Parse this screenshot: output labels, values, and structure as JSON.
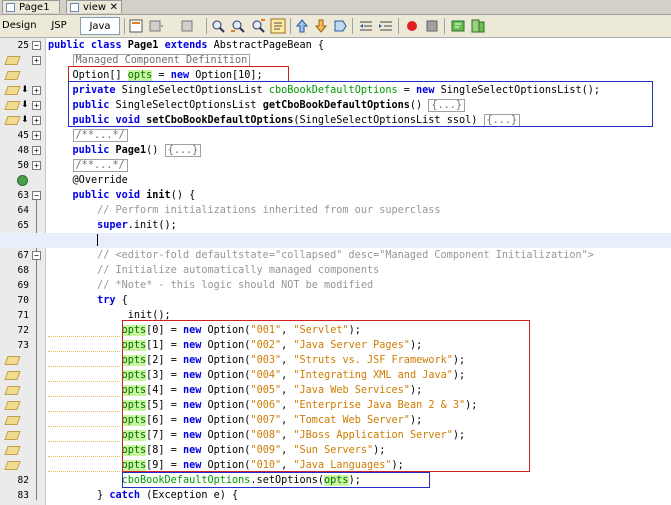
{
  "tabs": [
    {
      "label": "Page1"
    },
    {
      "label": "view"
    }
  ],
  "views": {
    "design": "Design",
    "jsp": "JSP",
    "java": "Java"
  },
  "toolbar_icons": [
    "history-icon",
    "back-icon",
    "forward-icon",
    "find-icon",
    "find-prev-icon",
    "find-next-icon",
    "toggle-highlight-icon",
    "prev-bookmark-icon",
    "next-bookmark-icon",
    "toggle-bookmark-icon",
    "shift-left-icon",
    "shift-right-icon",
    "record-macro-icon",
    "stop-macro-icon",
    "run-icon",
    "diff-icon"
  ],
  "editor": {
    "lines": [
      {
        "num": "25",
        "fold": "minus"
      },
      {
        "num": "",
        "fold": "plus",
        "badge": true
      },
      {
        "num": "",
        "badge": true
      },
      {
        "num": "",
        "fold": "plus",
        "badge": true,
        "arrow": true
      },
      {
        "num": "",
        "fold": "plus",
        "badge": true,
        "arrow": true
      },
      {
        "num": "",
        "fold": "plus",
        "badge": true,
        "arrow": true
      },
      {
        "num": "45",
        "fold": "plus"
      },
      {
        "num": "48",
        "fold": "plus"
      },
      {
        "num": "50",
        "fold": "plus"
      },
      {
        "num": "",
        "override": true
      },
      {
        "num": "63",
        "fold": "minus"
      },
      {
        "num": "64"
      },
      {
        "num": "65"
      },
      {
        "num": "",
        "current": true
      },
      {
        "num": "67",
        "fold": "minus"
      },
      {
        "num": "68"
      },
      {
        "num": "69"
      },
      {
        "num": "70"
      },
      {
        "num": "71"
      },
      {
        "num": "72"
      },
      {
        "num": "73"
      },
      {
        "num": "",
        "badge": true
      },
      {
        "num": "",
        "badge": true
      },
      {
        "num": "",
        "badge": true
      },
      {
        "num": "",
        "badge": true
      },
      {
        "num": "",
        "badge": true
      },
      {
        "num": "",
        "badge": true
      },
      {
        "num": "",
        "badge": true
      },
      {
        "num": "",
        "badge": true
      },
      {
        "num": "82"
      },
      {
        "num": "83"
      }
    ],
    "code": [
      "<span class=\"kw\">public class</span> <span class=\"b\">Page1</span> <span class=\"kw\">extends</span> AbstractPageBean {",
      "    <span class=\"folded\">Managed Component Definition</span>",
      "    Option[] <span class=\"opts\">opts</span> = <span class=\"kw\">new</span> Option[10];",
      "    <span class=\"kw\">private</span> SingleSelectOptionsList <span class=\"fld\">cboBookDefaultOptions</span> = <span class=\"kw\">new</span> SingleSelectOptionsList();",
      "    <span class=\"kw\">public</span> SingleSelectOptionsList <span class=\"b\">getCboBookDefaultOptions</span>() <span class=\"folded\">{...}</span>",
      "    <span class=\"kw\">public void</span> <span class=\"b\">setCboBookDefaultOptions</span>(SingleSelectOptionsList ssol) <span class=\"folded\">{...}</span>",
      "    <span class=\"folded cm\">/**...*/</span>",
      "    <span class=\"kw\">public</span> <span class=\"b\">Page1</span>() <span class=\"folded\">{...}</span>",
      "    <span class=\"folded cm\">/**...*/</span>",
      "    <span class=\"ann\">@Override</span>",
      "    <span class=\"kw\">public void</span> <span class=\"b\">init</span>() {",
      "        <span class=\"cm\">// Perform initializations inherited from our superclass</span>",
      "        <span class=\"kw\">super</span>.init();",
      "        <span class=\"caret\"></span>",
      "        <span class=\"cm\">// &lt;editor-fold defaultstate=\"collapsed\" desc=\"Managed Component Initialization\"&gt;</span>",
      "        <span class=\"cm\">// Initialize automatically managed components</span>",
      "        <span class=\"cm\">// *Note* - this logic should NOT be modified</span>",
      "        <span class=\"kw\">try</span> {",
      "            _init();",
      "            <span class=\"opts\">opts</span>[0] = <span class=\"kw\">new</span> Option(<span class=\"str\">\"001\"</span>, <span class=\"str\">\"Servlet\"</span>);",
      "            <span class=\"opts\">opts</span>[1] = <span class=\"kw\">new</span> Option(<span class=\"str\">\"002\"</span>, <span class=\"str\">\"Java Server Pages\"</span>);",
      "            <span class=\"opts\">opts</span>[2] = <span class=\"kw\">new</span> Option(<span class=\"str\">\"003\"</span>, <span class=\"str\">\"Struts vs. JSF Framework\"</span>);",
      "            <span class=\"opts\">opts</span>[3] = <span class=\"kw\">new</span> Option(<span class=\"str\">\"004\"</span>, <span class=\"str\">\"Integrating XML and Java\"</span>);",
      "            <span class=\"opts\">opts</span>[4] = <span class=\"kw\">new</span> Option(<span class=\"str\">\"005\"</span>, <span class=\"str\">\"Java Web Services\"</span>);",
      "            <span class=\"opts\">opts</span>[5] = <span class=\"kw\">new</span> Option(<span class=\"str\">\"006\"</span>, <span class=\"str\">\"Enterprise Java Bean 2 &amp; 3\"</span>);",
      "            <span class=\"opts\">opts</span>[6] = <span class=\"kw\">new</span> Option(<span class=\"str\">\"007\"</span>, <span class=\"str\">\"Tomcat Web Server\"</span>);",
      "            <span class=\"opts\">opts</span>[7] = <span class=\"kw\">new</span> Option(<span class=\"str\">\"008\"</span>, <span class=\"str\">\"JBoss Application Server\"</span>);",
      "            <span class=\"opts\">opts</span>[8] = <span class=\"kw\">new</span> Option(<span class=\"str\">\"009\"</span>, <span class=\"str\">\"Sun Servers\"</span>);",
      "            <span class=\"opts\">opts</span>[9] = <span class=\"kw\">new</span> Option(<span class=\"str\">\"010\"</span>, <span class=\"str\">\"Java Languages\"</span>);",
      "            <span class=\"fld\">cboBookDefaultOptions</span>.setOptions(<span class=\"opts\">opts</span>);",
      "        } <span class=\"kw\">catch</span> (Exception e) {"
    ]
  }
}
